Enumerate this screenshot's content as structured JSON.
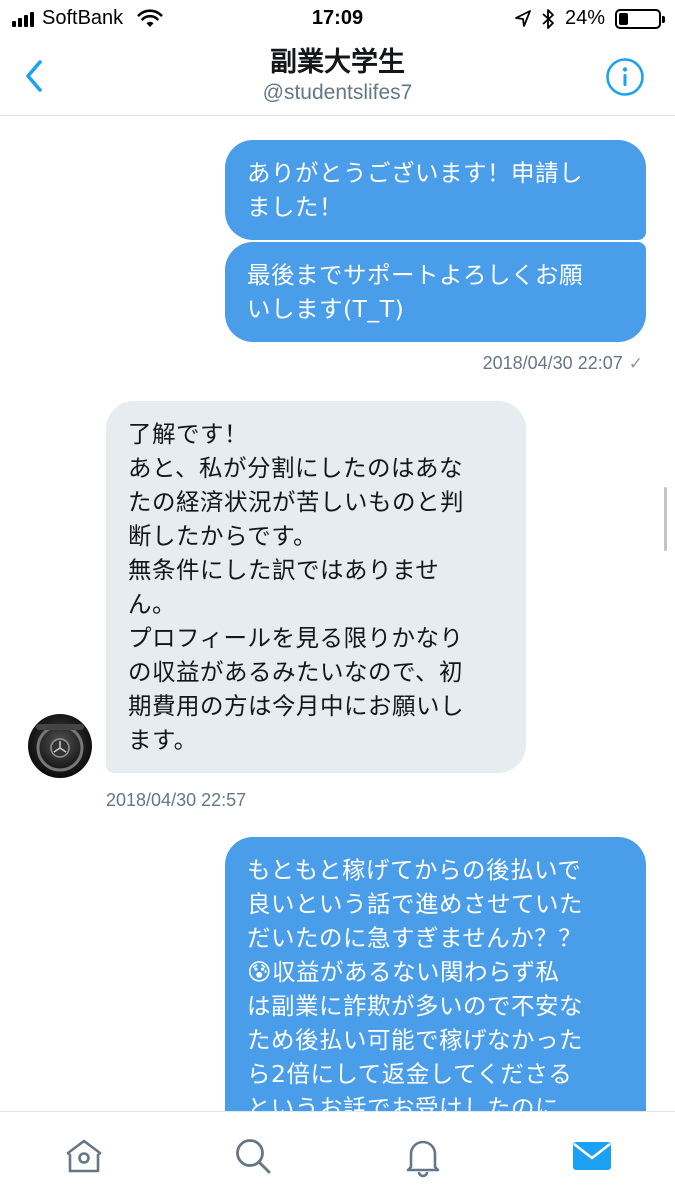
{
  "status_bar": {
    "carrier": "SoftBank",
    "time": "17:09",
    "battery": "24%",
    "battery_level": 0.24
  },
  "header": {
    "title": "副業大学生",
    "handle": "@studentslifes7"
  },
  "messages": [
    {
      "sender": "self",
      "lines": [
        "ありがとうございます！申請し",
        "ました！"
      ]
    },
    {
      "sender": "self",
      "lines": [
        "最後までサポートよろしくお願",
        "いします(T_T)"
      ]
    },
    {
      "sender": "self_timestamp",
      "text": "2018/04/30 22:07"
    },
    {
      "sender": "other",
      "lines": [
        "了解です！",
        "あと、私が分割にしたのはあな",
        "たの経済状況が苦しいものと判",
        "断したからです。",
        "無条件にした訳ではありませ",
        "ん。",
        "プロフィールを見る限りかなり",
        "の収益があるみたいなので、初",
        "期費用の方は今月中にお願いし",
        "ます。"
      ]
    },
    {
      "sender": "other_timestamp",
      "text": "2018/04/30 22:57"
    },
    {
      "sender": "self",
      "lines": [
        "もともと稼げてからの後払いで",
        "良いという話で進めさせていた",
        "だいたのに急すぎませんか？？",
        "😰収益があるない関わらず私",
        "は副業に詐欺が多いので不安な",
        "ため後払い可能で稼げなかった",
        "ら2倍にして返金してくださる",
        "というお話でお受けしたのに"
      ]
    }
  ],
  "icons": {
    "back": "chevron-left-icon",
    "info": "info-icon",
    "home": "home-icon",
    "search": "search-icon",
    "notifications": "bell-icon",
    "messages": "mail-icon"
  },
  "colors": {
    "accent": "#1da1f2",
    "sent_bubble": "#4a9de8",
    "received_bubble": "#e6ecf0"
  }
}
